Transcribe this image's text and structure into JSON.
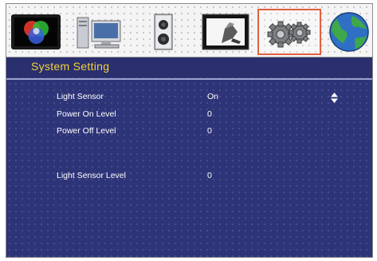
{
  "menu": {
    "title": "System Setting",
    "icons": [
      {
        "name": "color-settings-icon"
      },
      {
        "name": "pc-computer-icon"
      },
      {
        "name": "speaker-audio-icon"
      },
      {
        "name": "display-image-icon"
      },
      {
        "name": "system-gears-icon",
        "selected": true
      },
      {
        "name": "globe-language-icon"
      }
    ],
    "rows": [
      {
        "label": "Light Sensor",
        "value": "On"
      },
      {
        "label": "Power On Level",
        "value": "0"
      },
      {
        "label": "Power Off Level",
        "value": "0"
      },
      {
        "label": "Light Sensor Level",
        "value": "0"
      }
    ]
  },
  "colors": {
    "panel": "#2e3478",
    "title": "#f2d33a",
    "selection_outline": "#e06040",
    "text": "#ffffff"
  }
}
